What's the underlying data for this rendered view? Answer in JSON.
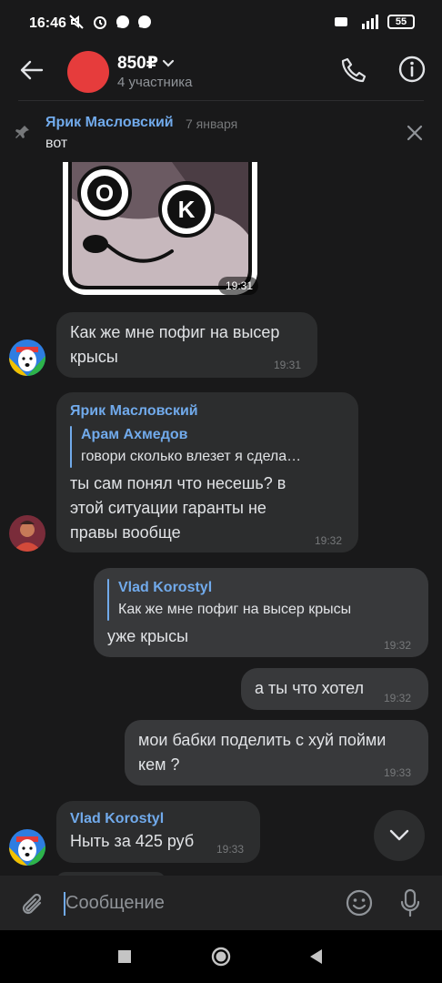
{
  "status_bar": {
    "time": "16:46",
    "battery": "55",
    "network": "4G"
  },
  "header": {
    "title": "850₽",
    "subtitle": "4 участника",
    "accent_color": "#e63c3c"
  },
  "pinned": {
    "author": "Ярик Масловский",
    "date": "7 января",
    "text": "вот"
  },
  "messages": [
    {
      "type": "sticker",
      "direction": "in",
      "time": "19:31",
      "sticker_letters": [
        "O",
        "K"
      ]
    },
    {
      "type": "text",
      "direction": "in",
      "text_lines": [
        "Как же мне пофиг на высер",
        "крысы"
      ],
      "time": "19:31"
    },
    {
      "type": "text",
      "direction": "in",
      "sender": "Ярик Масловский",
      "reply": {
        "author": "Арам Ахмедов",
        "text": "говори сколько влезет я сдела…"
      },
      "text_lines": [
        "ты сам понял что несешь? в",
        "этой ситуации гаранты не",
        "правы вообще"
      ],
      "time": "19:32"
    },
    {
      "type": "text",
      "direction": "out",
      "reply": {
        "author": "Vlad Korostyl",
        "text": "Как же мне пофиг на высер крысы"
      },
      "text_lines": [
        "уже крысы"
      ],
      "time": "19:32"
    },
    {
      "type": "text",
      "direction": "out",
      "text_lines": [
        "а ты что хотел"
      ],
      "time": "19:32"
    },
    {
      "type": "text",
      "direction": "out",
      "text_lines": [
        "мои бабки поделить с хуй пойми",
        "кем ?"
      ],
      "time": "19:33"
    },
    {
      "type": "text",
      "direction": "in",
      "sender": "Vlad Korostyl",
      "text_lines": [
        "Ныть за 425 руб"
      ],
      "time": "19:33"
    }
  ],
  "composer": {
    "placeholder": "Сообщение"
  },
  "colors": {
    "background": "#19191a",
    "bubble_in": "#2c2d2e",
    "bubble_out": "#38393b",
    "link": "#71aaeb"
  }
}
